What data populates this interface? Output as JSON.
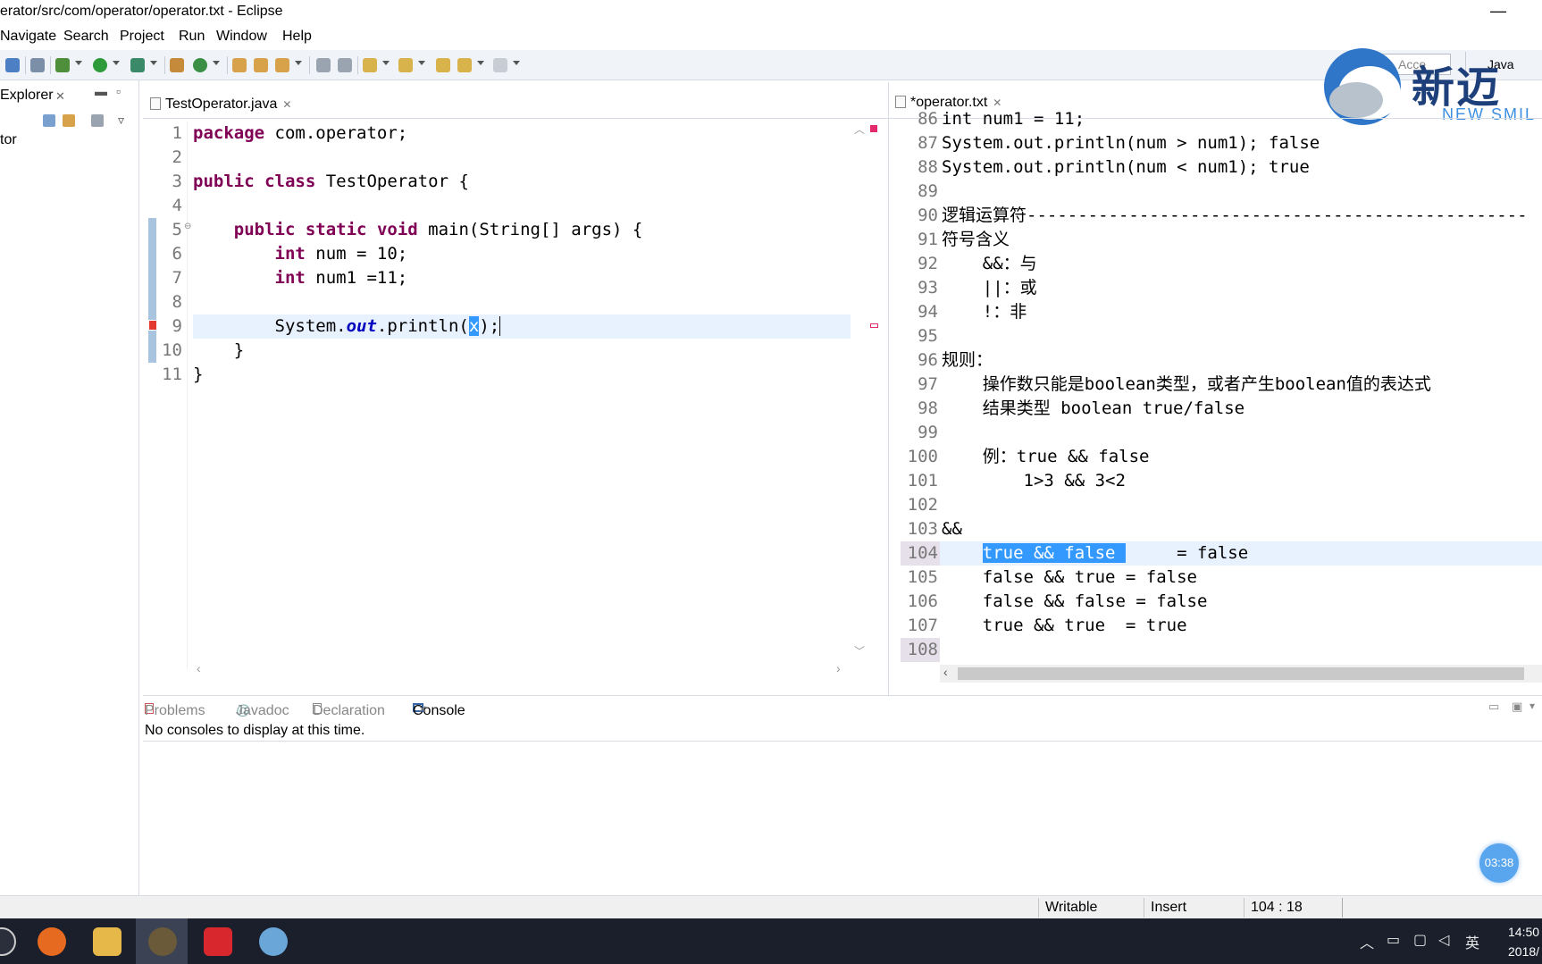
{
  "window": {
    "title": "erator/src/com/operator/operator.txt - Eclipse",
    "minimize": "—"
  },
  "menu": [
    "Navigate",
    "Search",
    "Project",
    "Run",
    "Window",
    "Help"
  ],
  "toolbar": {
    "quick_access": "Acce",
    "perspective": "Java"
  },
  "logo": {
    "cn": "新迈",
    "en": "NEW SMIL"
  },
  "explorer": {
    "tab_label": "Explorer",
    "close": "✕",
    "item": "tor"
  },
  "left_editor": {
    "tab_label": "TestOperator.java",
    "close": "✕",
    "line_numbers": [
      "1",
      "2",
      "3",
      "4",
      "5",
      "6",
      "7",
      "8",
      "9",
      "10",
      "11"
    ]
  },
  "right_editor": {
    "tab_label": "*operator.txt",
    "close": "✕",
    "line_numbers": [
      "86",
      "87",
      "88",
      "89",
      "90",
      "91",
      "92",
      "93",
      "94",
      "95",
      "96",
      "97",
      "98",
      "99",
      "100",
      "101",
      "102",
      "103",
      "104",
      "105",
      "106",
      "107",
      "108"
    ],
    "lines": [
      "int num1 = 11;",
      "System.out.println(num > num1); false",
      "System.out.println(num < num1); true",
      "",
      "逻辑运算符-------------------------------------------------",
      "符号含义",
      "    &&：与",
      "    ||：或",
      "    !：非",
      "",
      "规则：",
      "    操作数只能是boolean类型，或者产生boolean值的表达式",
      "    结果类型 boolean true/false",
      "",
      "    例：true && false",
      "        1>3 && 3<2",
      "",
      "&&",
      "     = false",
      "    false && true = false",
      "    false && false = false",
      "    true && true  = true",
      ""
    ],
    "selected_text": "true && false "
  },
  "console": {
    "tabs": [
      "Problems",
      "Javadoc",
      "Declaration",
      "Console"
    ],
    "message": "No consoles to display at this time."
  },
  "timer": "03:38",
  "status": {
    "writable": "Writable",
    "mode": "Insert",
    "position": "104 : 18"
  },
  "taskbar": {
    "ime": "英",
    "time": "14:50",
    "date": "2018/"
  }
}
